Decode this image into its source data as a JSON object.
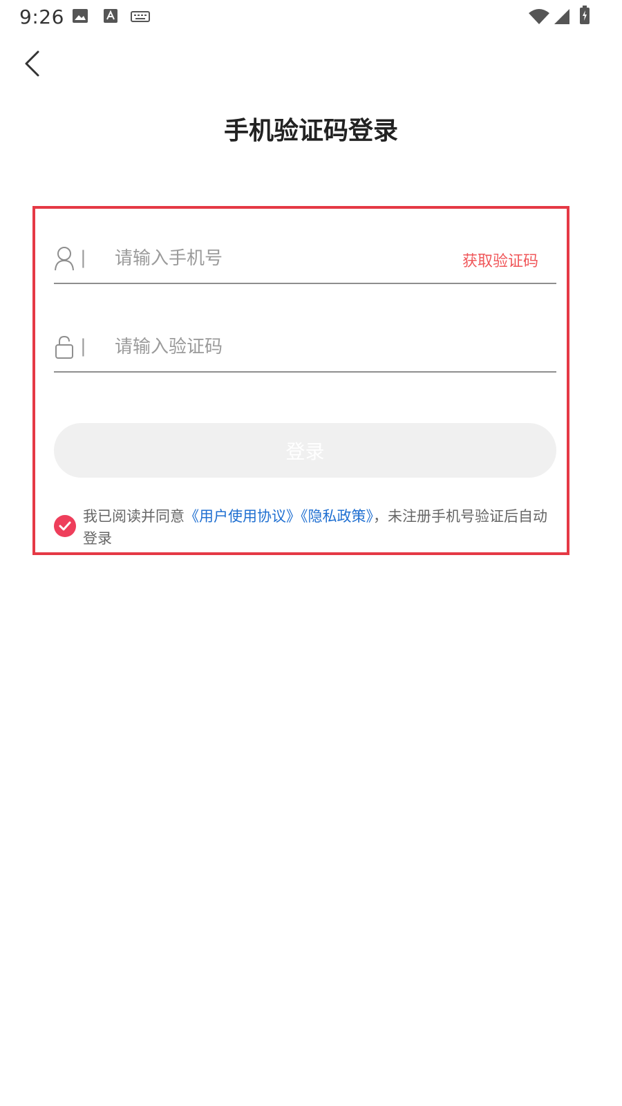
{
  "status_bar": {
    "time": "9:26",
    "icons": [
      "image-icon",
      "text-a-icon",
      "keyboard-icon",
      "wifi-icon",
      "signal-icon",
      "battery-charging-icon"
    ]
  },
  "header": {
    "back_icon": "chevron-left-icon",
    "title": "手机验证码登录"
  },
  "form": {
    "phone": {
      "icon": "user-icon",
      "separator": "|",
      "placeholder": "请输入手机号",
      "value": "",
      "get_code_label": "获取验证码"
    },
    "code": {
      "icon": "lock-icon",
      "separator": "|",
      "placeholder": "请输入验证码",
      "value": ""
    },
    "login_label": "登录",
    "agreement": {
      "checked": true,
      "prefix": "我已阅读并同意",
      "user_agreement": "《用户使用协议》",
      "privacy_policy": "《隐私政策》",
      "suffix": "，未注册手机号验证后自动登录"
    }
  },
  "colors": {
    "highlight_border": "#e53945",
    "accent_red": "#f0575a",
    "check_red": "#ee3e5b",
    "link_blue": "#1f6fd1",
    "button_disabled": "#f0f0f0"
  }
}
